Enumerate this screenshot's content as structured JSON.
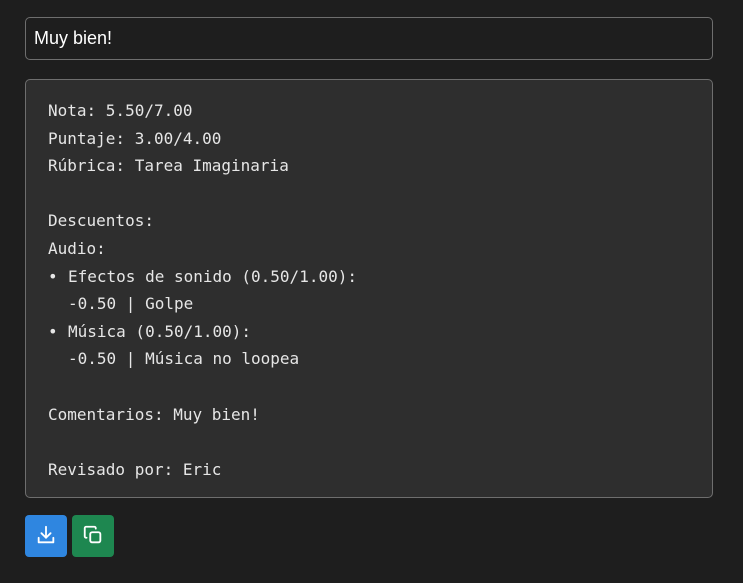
{
  "comment_input": {
    "value": "Muy bien!"
  },
  "report": {
    "nota": "Nota: 5.50/7.00",
    "puntaje": "Puntaje: 3.00/4.00",
    "rubrica": "Rúbrica: Tarea Imaginaria",
    "descuentos_heading": "Descuentos:",
    "category": "Audio:",
    "items": [
      {
        "title": "Efectos de sonido (0.50/1.00):",
        "deduction": "-0.50 | Golpe"
      },
      {
        "title": "Música (0.50/1.00):",
        "deduction": "-0.50 | Música no loopea"
      }
    ],
    "comentarios": "Comentarios: Muy bien!",
    "revisado": "Revisado por: Eric"
  },
  "actions": {
    "download_icon": "download-icon",
    "copy_icon": "copy-icon",
    "download_color": "#2f86e0",
    "copy_color": "#1e8750"
  }
}
